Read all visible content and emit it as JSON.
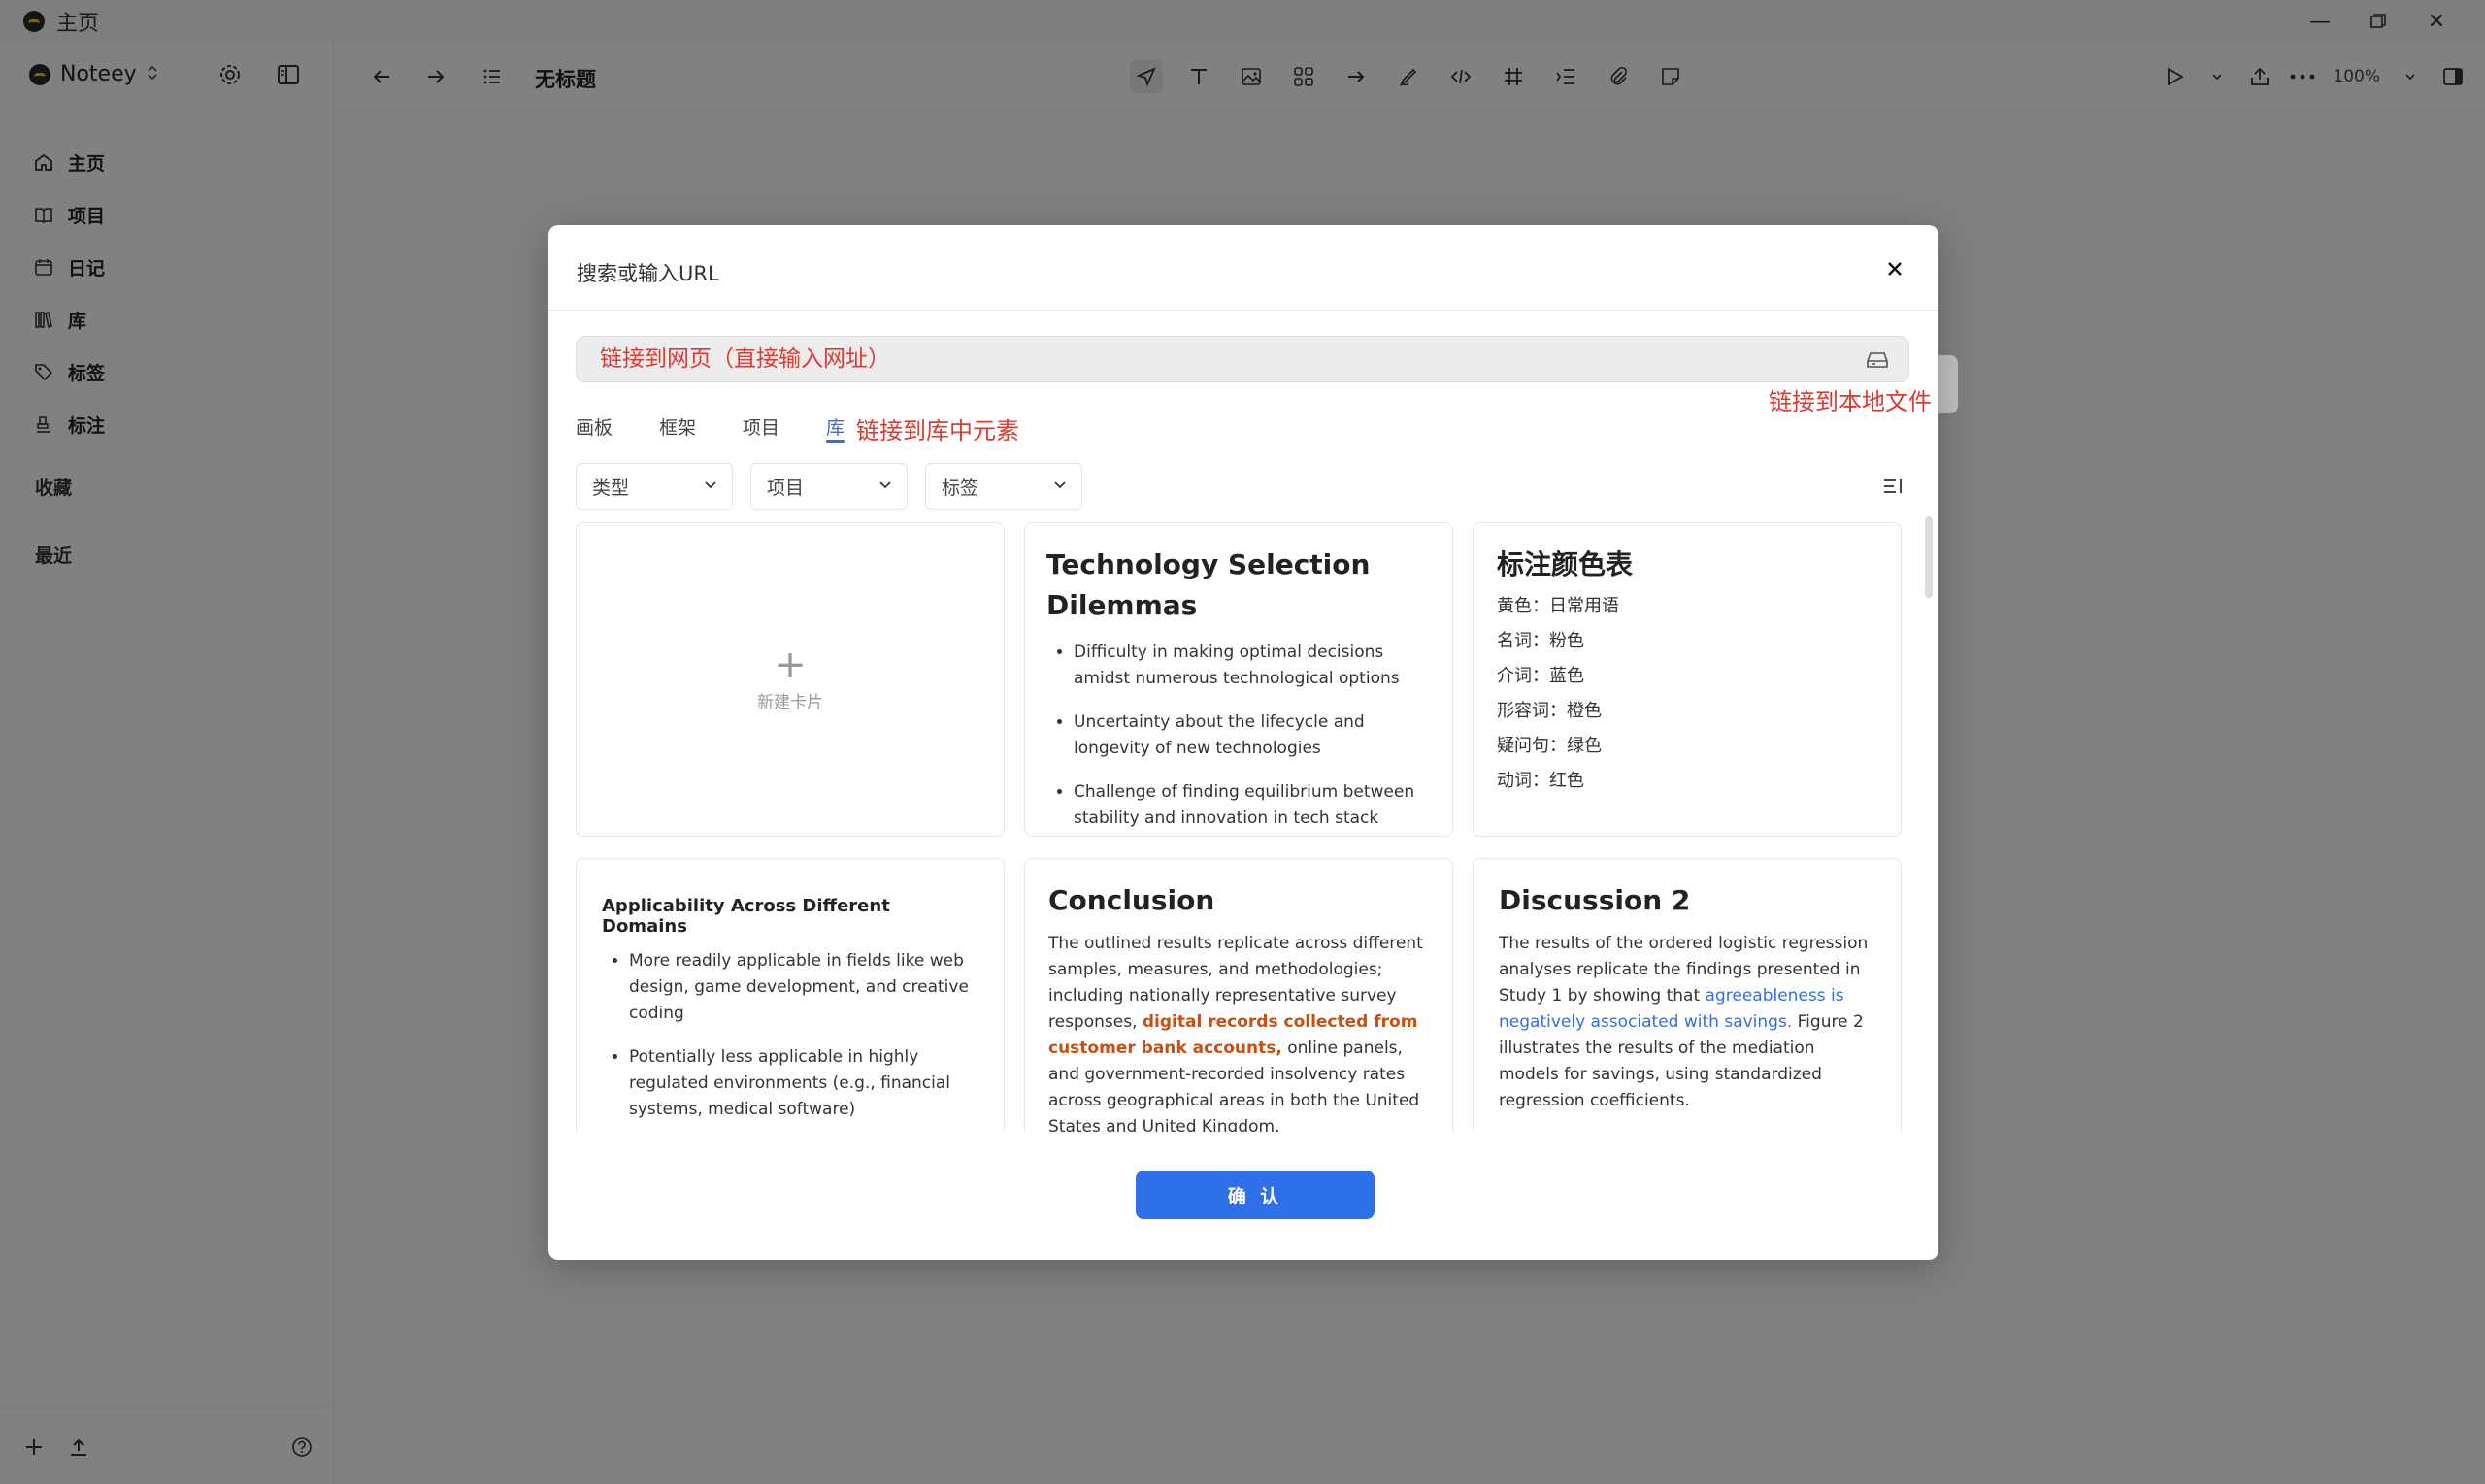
{
  "window": {
    "title": "主页",
    "controls": [
      "minimize",
      "maximize",
      "close"
    ]
  },
  "workspace": {
    "name": "Noteey"
  },
  "sidebar": {
    "items": [
      {
        "label": "主页",
        "icon": "home-icon"
      },
      {
        "label": "项目",
        "icon": "book-icon"
      },
      {
        "label": "日记",
        "icon": "calendar-icon"
      },
      {
        "label": "库",
        "icon": "library-icon"
      },
      {
        "label": "标签",
        "icon": "tag-icon"
      },
      {
        "label": "标注",
        "icon": "highlighter-icon"
      }
    ],
    "favorites_label": "收藏",
    "recent_label": "最近"
  },
  "topbar": {
    "doc_title": "无标题",
    "zoom": "100%"
  },
  "modal": {
    "title": "搜索或输入URL",
    "url_placeholder": "链接到网页（直接输入网址）",
    "annotation_local": "链接到本地文件",
    "annotation_library": "链接到库中元素",
    "tabs": [
      {
        "label": "画板",
        "active": false
      },
      {
        "label": "框架",
        "active": false
      },
      {
        "label": "项目",
        "active": false
      },
      {
        "label": "库",
        "active": true
      }
    ],
    "filters": [
      {
        "label": "类型"
      },
      {
        "label": "项目"
      },
      {
        "label": "标签"
      }
    ],
    "new_card_label": "新建卡片",
    "confirm_label": "确 认",
    "cards": {
      "tech": {
        "title": "Technology Selection Dilemmas",
        "bullets": [
          "Difficulty in making optimal decisions amidst numerous technological options",
          "Uncertainty about the lifecycle and longevity of new technologies",
          "Challenge of finding equilibrium between stability and innovation in tech stack choices"
        ]
      },
      "colors": {
        "title": "标注颜色表",
        "rows": [
          "黄色：日常用语",
          "名词：粉色",
          "介词：蓝色",
          "形容词：橙色",
          "疑问句：绿色",
          "动词：红色"
        ]
      },
      "applicability": {
        "title": "Applicability Across Different Domains",
        "bullets": [
          "More readily applicable in fields like web design, game development, and creative coding",
          "Potentially less applicable in highly regulated environments (e.g., financial systems, medical software)"
        ]
      },
      "conclusion": {
        "title": "Conclusion",
        "text_before": "The outlined results replicate across different samples, measures, and methodologies; including nationally representative survey responses, ",
        "highlight": "digital records collected from customer bank accounts,",
        "text_after": " online panels, and government-recorded insolvency rates across geographical areas in both the United States and United Kingdom."
      },
      "discussion": {
        "title": "Discussion 2",
        "text_before": "The results of the ordered logistic regression analyses replicate the findings presented in Study 1 by showing that ",
        "highlight": "agreeableness is negatively associated with savings.",
        "text_after": " Figure 2 illustrates the results of the mediation models for savings, using standardized regression coefficients."
      }
    }
  },
  "colors": {
    "accent": "#2f6fe8",
    "annotation": "#e03a30",
    "highlight_orange": "#c85010"
  }
}
